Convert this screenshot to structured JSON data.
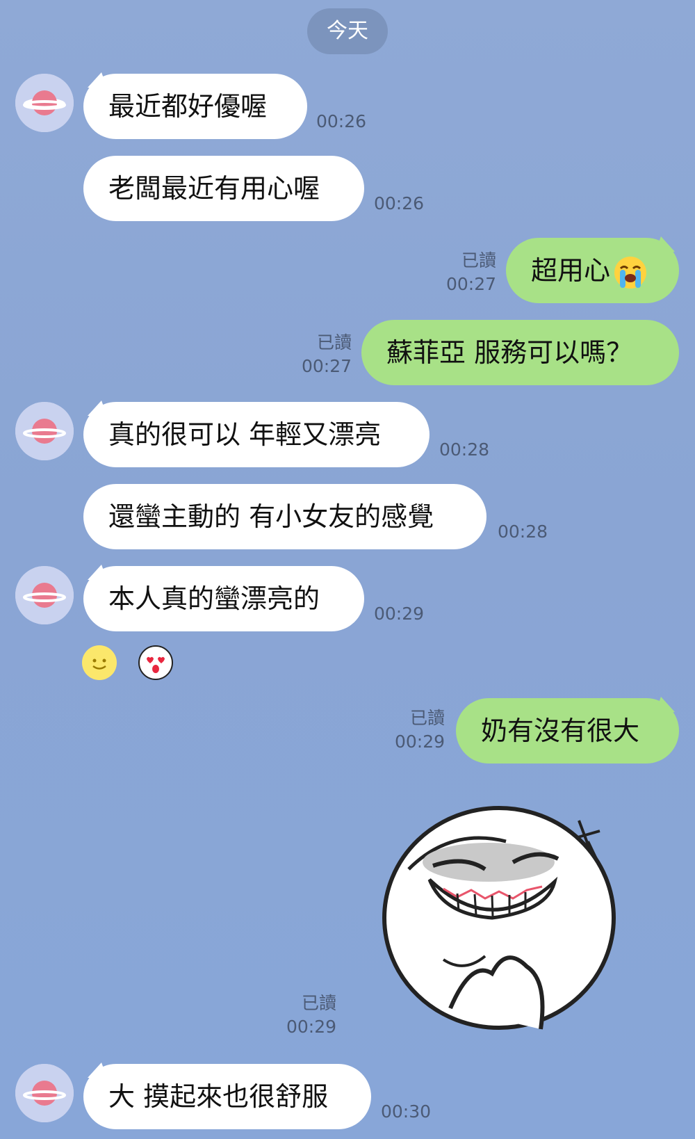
{
  "date_separator": "今天",
  "contact_avatar": "planet-avatar-icon",
  "messages": [
    {
      "direction": "incoming",
      "text": "最近都好優喔",
      "time": "00:26"
    },
    {
      "direction": "incoming",
      "text": "老闆最近有用心喔",
      "time": "00:26"
    },
    {
      "direction": "outgoing",
      "text": "超用心",
      "emoji": "crying-face-icon",
      "read": "已讀",
      "time": "00:27"
    },
    {
      "direction": "outgoing",
      "text": "蘇菲亞 服務可以嗎？",
      "read": "已讀",
      "time": "00:27"
    },
    {
      "direction": "incoming",
      "text": "真的很可以 年輕又漂亮",
      "time": "00:28"
    },
    {
      "direction": "incoming",
      "text": "還蠻主動的 有小女友的感覺",
      "time": "00:28"
    },
    {
      "direction": "incoming",
      "text": "本人真的蠻漂亮的",
      "time": "00:29"
    },
    {
      "direction": "outgoing",
      "text": "奶有沒有很大",
      "read": "已讀",
      "time": "00:29"
    },
    {
      "direction": "outgoing",
      "sticker": "smirking-face-sticker",
      "read": "已讀",
      "time": "00:29"
    },
    {
      "direction": "incoming",
      "text": "大 摸起來也很舒服",
      "time": "00:30"
    }
  ],
  "reactions": [
    "smiling-face-icon",
    "heart-eyes-face-icon"
  ],
  "colors": {
    "background": "#8aa7d6",
    "incoming_bubble": "#ffffff",
    "outgoing_bubble": "#a8e187",
    "meta_text": "#4b5a75"
  }
}
